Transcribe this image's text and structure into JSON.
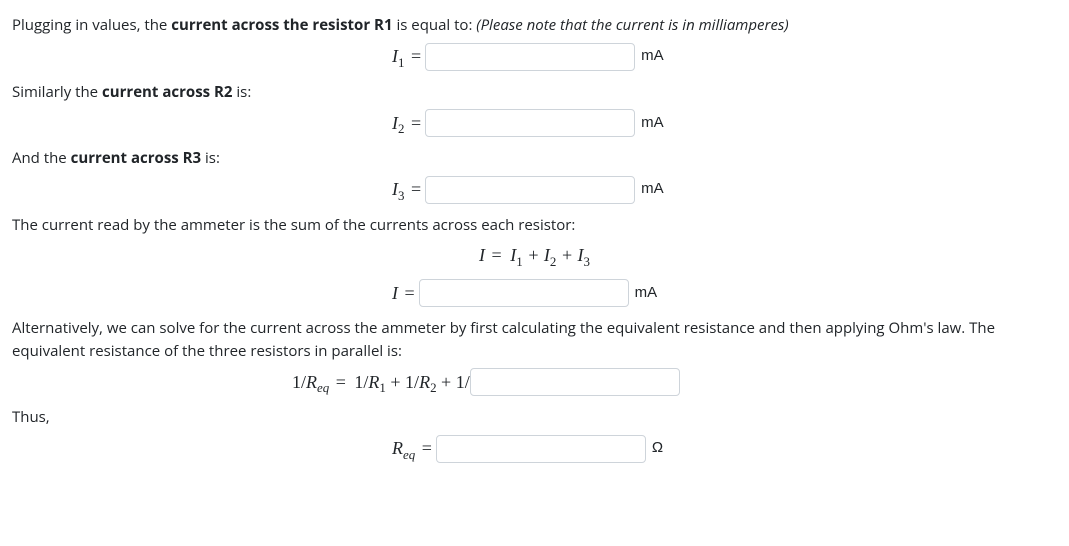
{
  "p1_a": "Plugging in values, the ",
  "p1_b": "current across the resistor R1",
  "p1_c": "  is equal to: ",
  "p1_note": "(Please note that the current is in milliamperes)",
  "i1_label_var": "I",
  "i1_label_sub": "1",
  "eq": "=",
  "unit_mA": "mA",
  "p2_a": "Similarly the ",
  "p2_b": "current across R2",
  "p2_c": " is:",
  "i2_label_sub": "2",
  "p3_a": "And the ",
  "p3_b": "current across R3",
  "p3_c": " is:",
  "i3_label_sub": "3",
  "p4": "The current read by the ammeter is the sum of the currents across each resistor:",
  "sum_eq": "I = I₁ + I₂ + I₃",
  "i_label_var": "I",
  "p5": "Alternatively, we can solve for the current across the ammeter by first calculating the equivalent resistance and then applying Ohm's law. The equivalent resistance of the three resistors in parallel is:",
  "req_lead": "1/",
  "req_R": "R",
  "req_eq_sub": "eq",
  "req_mid": " = 1/R₁ + 1/R₂ + 1/",
  "p6": "Thus,",
  "req_var": "R",
  "unit_ohm": "Ω"
}
